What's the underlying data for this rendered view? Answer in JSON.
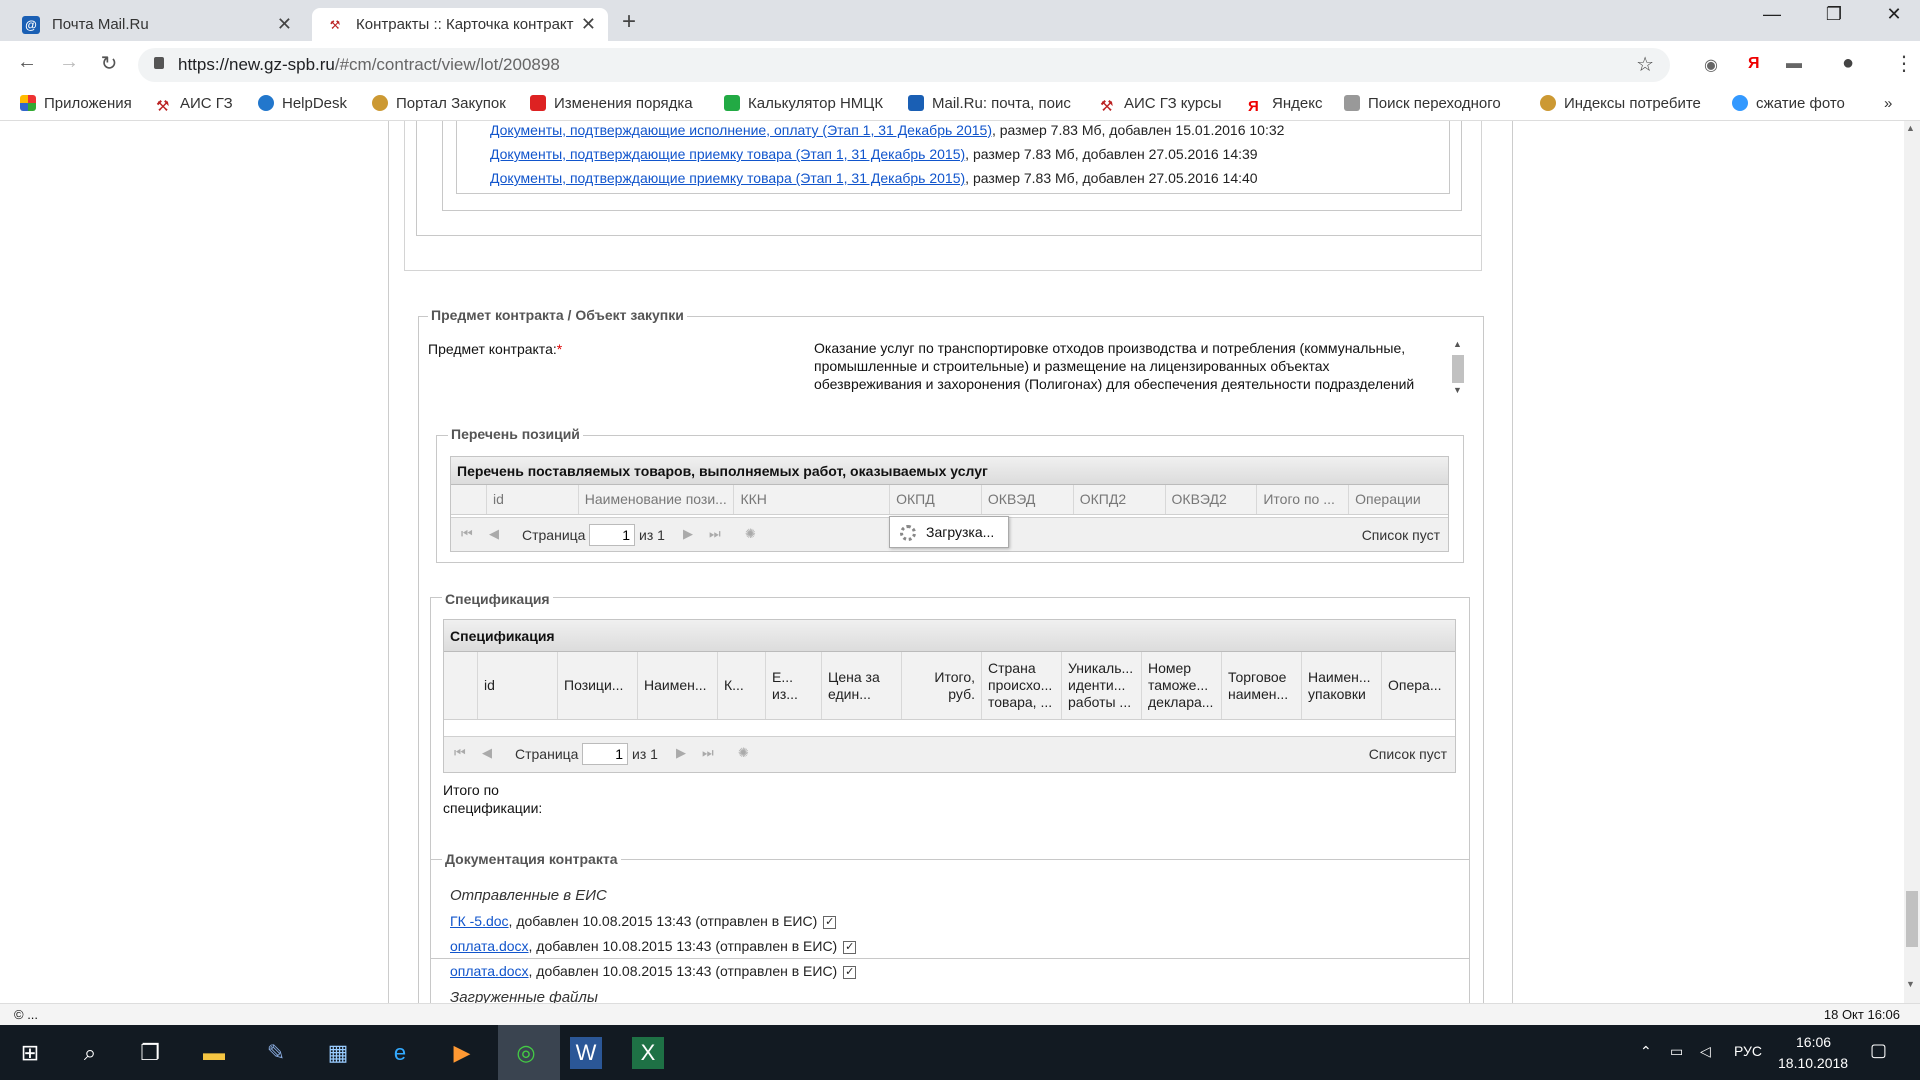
{
  "browser": {
    "tabs": [
      {
        "title": "Почта Mail.Ru",
        "favicon": "mail-icon"
      },
      {
        "title": "Контракты :: Карточка контракт",
        "favicon": "tools-icon"
      }
    ],
    "new_tab": "+",
    "url_host": "https://new.gz-spb.ru",
    "url_path": "/#cm/contract/view/lot/200898"
  },
  "bookmarks": [
    "Приложения",
    "АИС ГЗ",
    "HelpDesk",
    "Портал Закупок",
    "Изменения порядка",
    "Калькулятор НМЦК",
    "Mail.Ru: почта, поис",
    "АИС ГЗ курсы",
    "Яндекс",
    "Поиск переходного",
    "Индексы потребите",
    "сжатие фото"
  ],
  "bookmarks_more": "»",
  "docs_top": [
    {
      "link": "Документы, подтверждающие исполнение, оплату (Этап 1, 31 Декабрь 2015)",
      "meta": ", размер 7.83 Мб, добавлен 15.01.2016 10:32"
    },
    {
      "link": "Документы, подтверждающие приемку товара (Этап 1, 31 Декабрь 2015)",
      "meta": ", размер 7.83 Мб, добавлен 27.05.2016 14:39"
    },
    {
      "link": "Документы, подтверждающие приемку товара (Этап 1, 31 Декабрь 2015)",
      "meta": ", размер 7.83 Мб, добавлен 27.05.2016 14:40"
    }
  ],
  "subject": {
    "legend": "Предмет контракта / Объект закупки",
    "label": "Предмет контракта:",
    "required_mark": "*",
    "text": "Оказание услуг по транспортировке отходов производства и потребления (коммунальные, промышленные и строительные) и размещение на лицензированных объектах обезвреживания и захоронения (Полигонах) для обеспечения деятельности подразделений Санкт-Петербургского государственного казенного учреждения"
  },
  "positions": {
    "legend": "Перечень позиций",
    "grid_title": "Перечень поставляемых товаров, выполняемых работ, оказываемых услуг",
    "columns": [
      "id",
      "Наименование пози...",
      "ККН",
      "ОКПД",
      "ОКВЭД",
      "ОКПД2",
      "ОКВЭД2",
      "Итого по ...",
      "Операции"
    ],
    "loading": "Загрузка...",
    "pager": {
      "page_label": "Страница",
      "page": "1",
      "of": "из 1",
      "empty": "Список пуст"
    }
  },
  "spec": {
    "legend": "Спецификация",
    "grid_title": "Спецификация",
    "columns": [
      "id",
      "Позици...",
      "Наимен...",
      "К...",
      "Е... из...",
      "Цена за един...",
      "Итого, руб.",
      "Страна происхо... товара, ...",
      "Уникаль... иденти... работы ...",
      "Номер таможе... деклара...",
      "Торговое наимен...",
      "Наимен... упаковки",
      "Опера..."
    ],
    "pager": {
      "page_label": "Страница",
      "page": "1",
      "of": "из 1",
      "empty": "Список пуст"
    },
    "total_label_1": "Итого по",
    "total_label_2": "спецификации:"
  },
  "contract_docs": {
    "legend": "Документация контракта",
    "sent_heading": "Отправленные в ЕИС",
    "files": [
      {
        "link": "ГК -5.doc",
        "meta": ", добавлен 10.08.2015 13:43 (отправлен в ЕИС)"
      },
      {
        "link": "оплата.docx",
        "meta": ", добавлен 10.08.2015 13:43 (отправлен в ЕИС)"
      },
      {
        "link": "оплата.docx",
        "meta": ", добавлен 10.08.2015 13:43 (отправлен в ЕИС)"
      }
    ],
    "uploaded_heading": "Загруженные файлы"
  },
  "status": {
    "left": "© ...",
    "right": "18 Окт 16:06"
  },
  "taskbar": {
    "lang": "РУС",
    "time": "16:06",
    "date": "18.10.2018"
  },
  "colors": {
    "link": "#1155cc",
    "required": "#dd0000",
    "taskbar": "#121a22"
  }
}
